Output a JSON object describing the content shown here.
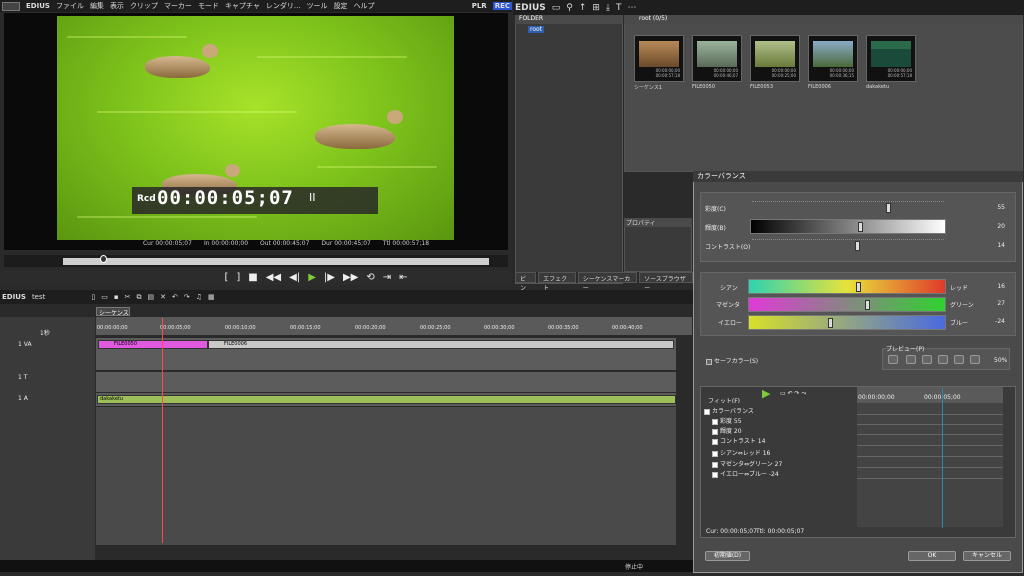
{
  "menubar": {
    "brand": "EDIUS",
    "items": [
      "ファイル",
      "編集",
      "表示",
      "クリップ",
      "マーカー",
      "モード",
      "キャプチャ",
      "レンダリ...",
      "ツール",
      "設定",
      "ヘルプ"
    ],
    "plr": "PLR",
    "rec": "REC"
  },
  "preview": {
    "rcd_label": "Rcd",
    "timecode": "00:00:05;07",
    "pause": "II",
    "cur": "Cur 00:00:05;07",
    "in": "In 00:00:00;00",
    "out": "Out 00:00:45;07",
    "dur": "Dur 00:00:45;07",
    "ttl": "Ttl 00:00:57;18",
    "progress": 0.09
  },
  "bin": {
    "brand": "EDIUS",
    "folder_header": "FOLDER",
    "root_label": "root",
    "clips_header": "root (0/5)",
    "clips": [
      {
        "name": "シーケンス1",
        "tc": "00:00:00;00\n00:00:57;18"
      },
      {
        "name": "FILE0050",
        "tc": "00:00:00;00\n00:00:46;07"
      },
      {
        "name": "FILE0053",
        "tc": "00:00:00;00\n00:00:25;00"
      },
      {
        "name": "FILE0006",
        "tc": "00:00:00;00\n00:00:36;15"
      },
      {
        "name": "dakaketu",
        "tc": "00:00:00;00\n00:00:57;18"
      }
    ],
    "properties": "プロパティ",
    "tabs": [
      "ビン",
      "エフェクト",
      "シーケンスマーカー",
      "ソースブラウザー"
    ]
  },
  "timeline": {
    "project": "test",
    "sequence_tab": "シーケンス1",
    "ruler": [
      "00:00:00;00",
      "00:00:05;00",
      "00:00:10;00",
      "00:00:15;00",
      "00:00:20;00",
      "00:00:25;00",
      "00:00:30;00",
      "00:00:35;00",
      "00:00:40;00"
    ],
    "tracks": [
      {
        "label": "1 VA"
      },
      {
        "label": "1 T"
      },
      {
        "label": "1 A"
      }
    ],
    "clip_a": "FILE0050",
    "clip_b": "FILE0006",
    "audio_clip": "dakaketu",
    "zoom": "1秒"
  },
  "status": {
    "stop": "停止中"
  },
  "dialog": {
    "title": "カラーバランス",
    "saturation_label": "彩度(C)",
    "saturation_value": "55",
    "brightness_label": "輝度(B)",
    "brightness_value": "20",
    "contrast_label": "コントラスト(O)",
    "contrast_value": "14",
    "cyan_label": "シアン",
    "red_label": "レッド",
    "cyan_value": "16",
    "magenta_label": "マゼンタ",
    "green_label": "グリーン",
    "magenta_value": "27",
    "yellow_label": "イエロー",
    "blue_label": "ブルー",
    "yellow_value": "-24",
    "safe_color": "セーフカラー(S)",
    "preview_label": "プレビュー(P)",
    "preview_pct": "50%",
    "fit_label": "フィット(F)",
    "kf_ruler_a": "00:00:00;00",
    "kf_ruler_b": "00:00:05;00",
    "tree": [
      "カラーバランス",
      "彩度  55",
      "輝度  20",
      "コントラスト  14",
      "シアン⇔レッド  16",
      "マゼンタ⇔グリーン  27",
      "イエロー⇔ブルー  -24"
    ],
    "cur": "Cur: 00:00:05;07",
    "ttl": "Ttl: 00:00:05;07",
    "reset": "初期値(D)",
    "ok": "OK",
    "cancel": "キャンセル"
  }
}
